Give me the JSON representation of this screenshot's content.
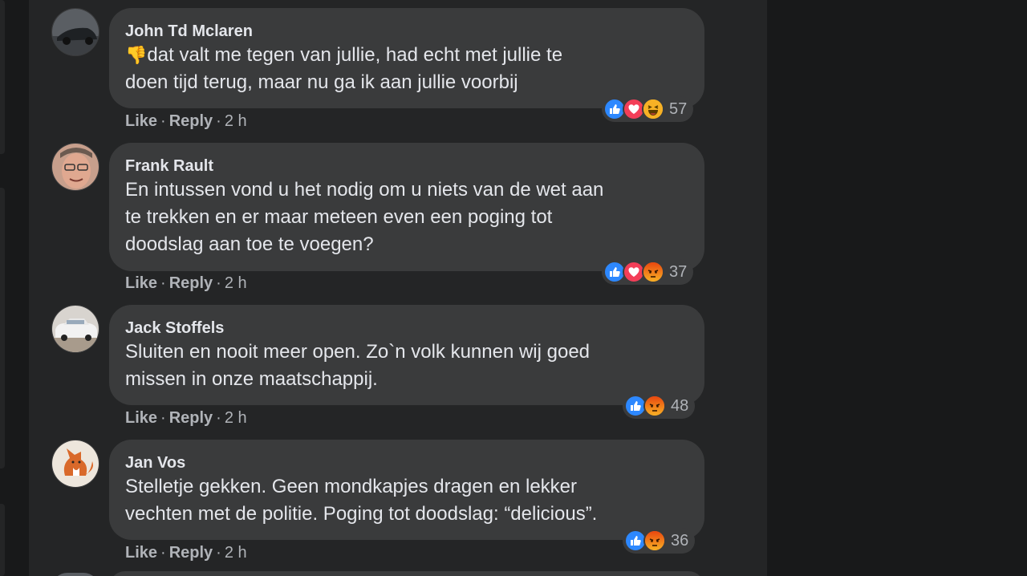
{
  "comments": [
    {
      "author": "John Td Mclaren",
      "emoji": "👎",
      "text": "dat valt me tegen van jullie, had echt met jullie te\ndoen tijd terug, maar nu ga ik aan jullie voorbij",
      "reactions": [
        "like",
        "love",
        "haha"
      ],
      "reaction_count": "57",
      "like_label": "Like",
      "reply_label": "Reply",
      "time": "2 h"
    },
    {
      "author": "Frank Rault",
      "emoji": "",
      "text": "En intussen vond u het nodig om u niets van de wet aan\nte trekken en er maar meteen even een poging tot\ndoodslag aan toe te voegen?",
      "reactions": [
        "like",
        "love",
        "angry"
      ],
      "reaction_count": "37",
      "like_label": "Like",
      "reply_label": "Reply",
      "time": "2 h"
    },
    {
      "author": "Jack Stoffels",
      "emoji": "",
      "text": "Sluiten en nooit meer open. Zo`n volk kunnen wij goed\nmissen in onze maatschappij.",
      "reactions": [
        "like",
        "angry"
      ],
      "reaction_count": "48",
      "like_label": "Like",
      "reply_label": "Reply",
      "time": "2 h"
    },
    {
      "author": "Jan Vos",
      "emoji": "",
      "text": "Stelletje gekken. Geen mondkapjes dragen en lekker\nvechten met de politie. Poging tot doodslag: “delicious”.",
      "reactions": [
        "like",
        "angry"
      ],
      "reaction_count": "36",
      "like_label": "Like",
      "reply_label": "Reply",
      "time": "2 h"
    }
  ],
  "colors": {
    "like": "#2d88ff",
    "love": "#f33e58",
    "haha": "#f7b125",
    "angry": "#e9710f",
    "bubble": "#3a3b3c",
    "panel": "#242526"
  }
}
